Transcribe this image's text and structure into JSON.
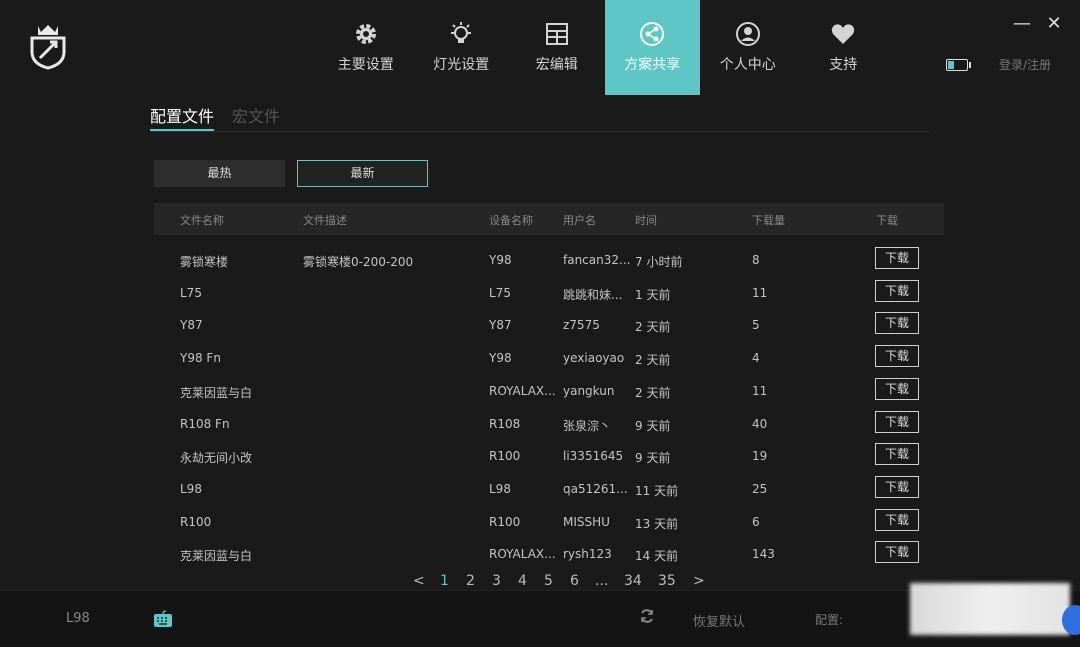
{
  "nav": [
    {
      "label": "主要设置",
      "icon": "gear-icon",
      "active": false
    },
    {
      "label": "灯光设置",
      "icon": "bulb-icon",
      "active": false
    },
    {
      "label": "宏编辑",
      "icon": "macro-grid-icon",
      "active": false
    },
    {
      "label": "方案共享",
      "icon": "share-icon",
      "active": true
    },
    {
      "label": "个人中心",
      "icon": "user-icon",
      "active": false
    },
    {
      "label": "支持",
      "icon": "heart-icon",
      "active": false
    }
  ],
  "window": {
    "minimize": "—",
    "close": "✕"
  },
  "login_label": "登录/注册",
  "subtabs": {
    "profiles": "配置文件",
    "macros": "宏文件"
  },
  "filters": {
    "hot": "最热",
    "new": "最新"
  },
  "columns": {
    "name": "文件名称",
    "desc": "文件描述",
    "device": "设备名称",
    "user": "用户名",
    "time": "时间",
    "downloads": "下载量",
    "action": "下载"
  },
  "rows": [
    {
      "name": "雾锁寒楼",
      "desc": "雾锁寒楼0-200-200",
      "device": "Y98",
      "user": "fancan32...",
      "time": "7 小时前",
      "downloads": "8",
      "action": "下载"
    },
    {
      "name": "L75",
      "desc": "",
      "device": "L75",
      "user": "跳跳和妹...",
      "time": "1 天前",
      "downloads": "11",
      "action": "下载"
    },
    {
      "name": "Y87",
      "desc": "",
      "device": "Y87",
      "user": "z7575",
      "time": "2 天前",
      "downloads": "5",
      "action": "下载"
    },
    {
      "name": "Y98  Fn",
      "desc": "",
      "device": "Y98",
      "user": "yexiaoyao",
      "time": "2 天前",
      "downloads": "4",
      "action": "下载"
    },
    {
      "name": "克莱因蓝与白",
      "desc": "",
      "device": "ROYALAX...",
      "user": "yangkun",
      "time": "2 天前",
      "downloads": "11",
      "action": "下载"
    },
    {
      "name": "R108  Fn",
      "desc": "",
      "device": "R108",
      "user": "张泉淙丶",
      "time": "9 天前",
      "downloads": "40",
      "action": "下载"
    },
    {
      "name": "永劫无间小改",
      "desc": "",
      "device": "R100",
      "user": "li3351645",
      "time": "9 天前",
      "downloads": "19",
      "action": "下载"
    },
    {
      "name": "L98",
      "desc": "",
      "device": "L98",
      "user": "qa51261...",
      "time": "11 天前",
      "downloads": "25",
      "action": "下载"
    },
    {
      "name": "R100",
      "desc": "",
      "device": "R100",
      "user": "MISSHU",
      "time": "13 天前",
      "downloads": "6",
      "action": "下载"
    },
    {
      "name": "克莱因蓝与白",
      "desc": "",
      "device": "ROYALAX...",
      "user": "rysh123",
      "time": "14 天前",
      "downloads": "143",
      "action": "下载"
    }
  ],
  "pagination": {
    "prev": "<",
    "pages": [
      "1",
      "2",
      "3",
      "4",
      "5",
      "6",
      "...",
      "34",
      "35"
    ],
    "current": "1",
    "next": ">"
  },
  "footer": {
    "device": "L98",
    "restore": "恢复默认",
    "config_label": "配置:"
  },
  "colors": {
    "accent": "#5ec7c6",
    "background": "#1a1a1a"
  }
}
